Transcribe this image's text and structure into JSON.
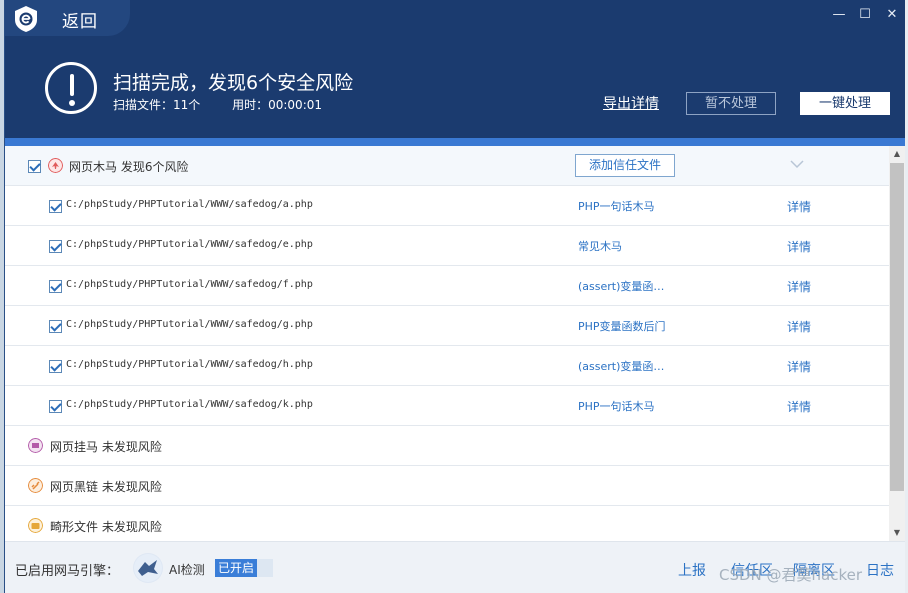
{
  "window": {
    "back_label": "返回",
    "controls": {
      "minimize": "—",
      "maximize": "☐",
      "close": "✕"
    }
  },
  "banner": {
    "title": "扫描完成，发现6个安全风险",
    "files_scanned": "扫描文件：11个",
    "time_used": "用时：00:00:01",
    "export_label": "导出详情",
    "ignore_label": "暂不处理",
    "fix_label": "一键处理"
  },
  "groups": [
    {
      "label": "网页木马  发现6个风险",
      "trust_button": "添加信任文件",
      "icon": "trojan-icon",
      "color": "#e05a5a"
    },
    {
      "label": "网页挂马  未发现风险",
      "icon": "hanging-trojan-icon",
      "color": "#b35aa8"
    },
    {
      "label": "网页黑链  未发现风险",
      "icon": "black-link-icon",
      "color": "#e58a3a"
    },
    {
      "label": "畸形文件  未发现风险",
      "icon": "malformed-file-icon",
      "color": "#e5a73a"
    }
  ],
  "files": [
    {
      "path": "C:/phpStudy/PHPTutorial/WWW/safedog/a.php",
      "type": "PHP一句话木马",
      "detail": "详情"
    },
    {
      "path": "C:/phpStudy/PHPTutorial/WWW/safedog/e.php",
      "type": "常见木马",
      "detail": "详情"
    },
    {
      "path": "C:/phpStudy/PHPTutorial/WWW/safedog/f.php",
      "type": "(assert)变量函…",
      "detail": "详情"
    },
    {
      "path": "C:/phpStudy/PHPTutorial/WWW/safedog/g.php",
      "type": "PHP变量函数后门",
      "detail": "详情"
    },
    {
      "path": "C:/phpStudy/PHPTutorial/WWW/safedog/h.php",
      "type": "(assert)变量函…",
      "detail": "详情"
    },
    {
      "path": "C:/phpStudy/PHPTutorial/WWW/safedog/k.php",
      "type": "PHP一句话木马",
      "detail": "详情"
    }
  ],
  "footer": {
    "engine_label": "已启用网马引擎：",
    "ai_label": "AI检测",
    "ai_status": "已开启",
    "links": [
      "上报",
      "信任区",
      "隔离区",
      "日志"
    ],
    "watermark": "CSDN @君莫hacker"
  },
  "colors": {
    "header": "#1b3b6f",
    "accent": "#3a79d3",
    "link": "#2b72c4"
  }
}
